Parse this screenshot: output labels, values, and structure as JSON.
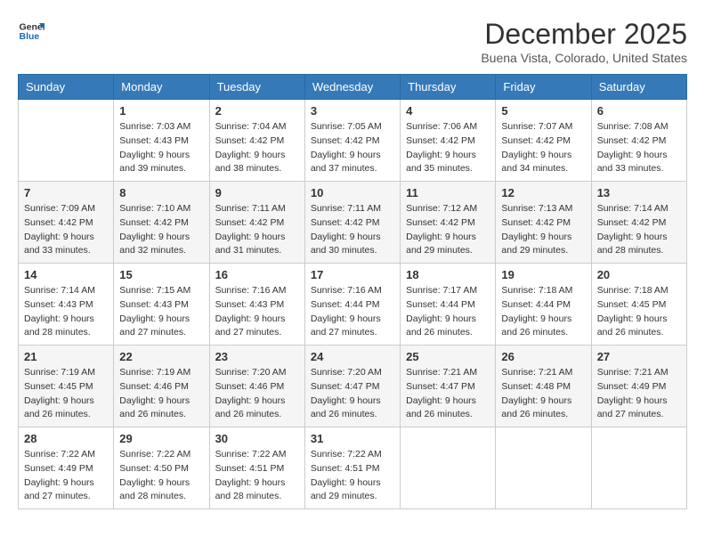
{
  "logo": {
    "line1": "General",
    "line2": "Blue"
  },
  "title": "December 2025",
  "location": "Buena Vista, Colorado, United States",
  "days_of_week": [
    "Sunday",
    "Monday",
    "Tuesday",
    "Wednesday",
    "Thursday",
    "Friday",
    "Saturday"
  ],
  "weeks": [
    [
      {
        "day": "",
        "sunrise": "",
        "sunset": "",
        "daylight": ""
      },
      {
        "day": "1",
        "sunrise": "Sunrise: 7:03 AM",
        "sunset": "Sunset: 4:43 PM",
        "daylight": "Daylight: 9 hours and 39 minutes."
      },
      {
        "day": "2",
        "sunrise": "Sunrise: 7:04 AM",
        "sunset": "Sunset: 4:42 PM",
        "daylight": "Daylight: 9 hours and 38 minutes."
      },
      {
        "day": "3",
        "sunrise": "Sunrise: 7:05 AM",
        "sunset": "Sunset: 4:42 PM",
        "daylight": "Daylight: 9 hours and 37 minutes."
      },
      {
        "day": "4",
        "sunrise": "Sunrise: 7:06 AM",
        "sunset": "Sunset: 4:42 PM",
        "daylight": "Daylight: 9 hours and 35 minutes."
      },
      {
        "day": "5",
        "sunrise": "Sunrise: 7:07 AM",
        "sunset": "Sunset: 4:42 PM",
        "daylight": "Daylight: 9 hours and 34 minutes."
      },
      {
        "day": "6",
        "sunrise": "Sunrise: 7:08 AM",
        "sunset": "Sunset: 4:42 PM",
        "daylight": "Daylight: 9 hours and 33 minutes."
      }
    ],
    [
      {
        "day": "7",
        "sunrise": "Sunrise: 7:09 AM",
        "sunset": "Sunset: 4:42 PM",
        "daylight": "Daylight: 9 hours and 33 minutes."
      },
      {
        "day": "8",
        "sunrise": "Sunrise: 7:10 AM",
        "sunset": "Sunset: 4:42 PM",
        "daylight": "Daylight: 9 hours and 32 minutes."
      },
      {
        "day": "9",
        "sunrise": "Sunrise: 7:11 AM",
        "sunset": "Sunset: 4:42 PM",
        "daylight": "Daylight: 9 hours and 31 minutes."
      },
      {
        "day": "10",
        "sunrise": "Sunrise: 7:11 AM",
        "sunset": "Sunset: 4:42 PM",
        "daylight": "Daylight: 9 hours and 30 minutes."
      },
      {
        "day": "11",
        "sunrise": "Sunrise: 7:12 AM",
        "sunset": "Sunset: 4:42 PM",
        "daylight": "Daylight: 9 hours and 29 minutes."
      },
      {
        "day": "12",
        "sunrise": "Sunrise: 7:13 AM",
        "sunset": "Sunset: 4:42 PM",
        "daylight": "Daylight: 9 hours and 29 minutes."
      },
      {
        "day": "13",
        "sunrise": "Sunrise: 7:14 AM",
        "sunset": "Sunset: 4:42 PM",
        "daylight": "Daylight: 9 hours and 28 minutes."
      }
    ],
    [
      {
        "day": "14",
        "sunrise": "Sunrise: 7:14 AM",
        "sunset": "Sunset: 4:43 PM",
        "daylight": "Daylight: 9 hours and 28 minutes."
      },
      {
        "day": "15",
        "sunrise": "Sunrise: 7:15 AM",
        "sunset": "Sunset: 4:43 PM",
        "daylight": "Daylight: 9 hours and 27 minutes."
      },
      {
        "day": "16",
        "sunrise": "Sunrise: 7:16 AM",
        "sunset": "Sunset: 4:43 PM",
        "daylight": "Daylight: 9 hours and 27 minutes."
      },
      {
        "day": "17",
        "sunrise": "Sunrise: 7:16 AM",
        "sunset": "Sunset: 4:44 PM",
        "daylight": "Daylight: 9 hours and 27 minutes."
      },
      {
        "day": "18",
        "sunrise": "Sunrise: 7:17 AM",
        "sunset": "Sunset: 4:44 PM",
        "daylight": "Daylight: 9 hours and 26 minutes."
      },
      {
        "day": "19",
        "sunrise": "Sunrise: 7:18 AM",
        "sunset": "Sunset: 4:44 PM",
        "daylight": "Daylight: 9 hours and 26 minutes."
      },
      {
        "day": "20",
        "sunrise": "Sunrise: 7:18 AM",
        "sunset": "Sunset: 4:45 PM",
        "daylight": "Daylight: 9 hours and 26 minutes."
      }
    ],
    [
      {
        "day": "21",
        "sunrise": "Sunrise: 7:19 AM",
        "sunset": "Sunset: 4:45 PM",
        "daylight": "Daylight: 9 hours and 26 minutes."
      },
      {
        "day": "22",
        "sunrise": "Sunrise: 7:19 AM",
        "sunset": "Sunset: 4:46 PM",
        "daylight": "Daylight: 9 hours and 26 minutes."
      },
      {
        "day": "23",
        "sunrise": "Sunrise: 7:20 AM",
        "sunset": "Sunset: 4:46 PM",
        "daylight": "Daylight: 9 hours and 26 minutes."
      },
      {
        "day": "24",
        "sunrise": "Sunrise: 7:20 AM",
        "sunset": "Sunset: 4:47 PM",
        "daylight": "Daylight: 9 hours and 26 minutes."
      },
      {
        "day": "25",
        "sunrise": "Sunrise: 7:21 AM",
        "sunset": "Sunset: 4:47 PM",
        "daylight": "Daylight: 9 hours and 26 minutes."
      },
      {
        "day": "26",
        "sunrise": "Sunrise: 7:21 AM",
        "sunset": "Sunset: 4:48 PM",
        "daylight": "Daylight: 9 hours and 26 minutes."
      },
      {
        "day": "27",
        "sunrise": "Sunrise: 7:21 AM",
        "sunset": "Sunset: 4:49 PM",
        "daylight": "Daylight: 9 hours and 27 minutes."
      }
    ],
    [
      {
        "day": "28",
        "sunrise": "Sunrise: 7:22 AM",
        "sunset": "Sunset: 4:49 PM",
        "daylight": "Daylight: 9 hours and 27 minutes."
      },
      {
        "day": "29",
        "sunrise": "Sunrise: 7:22 AM",
        "sunset": "Sunset: 4:50 PM",
        "daylight": "Daylight: 9 hours and 28 minutes."
      },
      {
        "day": "30",
        "sunrise": "Sunrise: 7:22 AM",
        "sunset": "Sunset: 4:51 PM",
        "daylight": "Daylight: 9 hours and 28 minutes."
      },
      {
        "day": "31",
        "sunrise": "Sunrise: 7:22 AM",
        "sunset": "Sunset: 4:51 PM",
        "daylight": "Daylight: 9 hours and 29 minutes."
      },
      {
        "day": "",
        "sunrise": "",
        "sunset": "",
        "daylight": ""
      },
      {
        "day": "",
        "sunrise": "",
        "sunset": "",
        "daylight": ""
      },
      {
        "day": "",
        "sunrise": "",
        "sunset": "",
        "daylight": ""
      }
    ]
  ]
}
